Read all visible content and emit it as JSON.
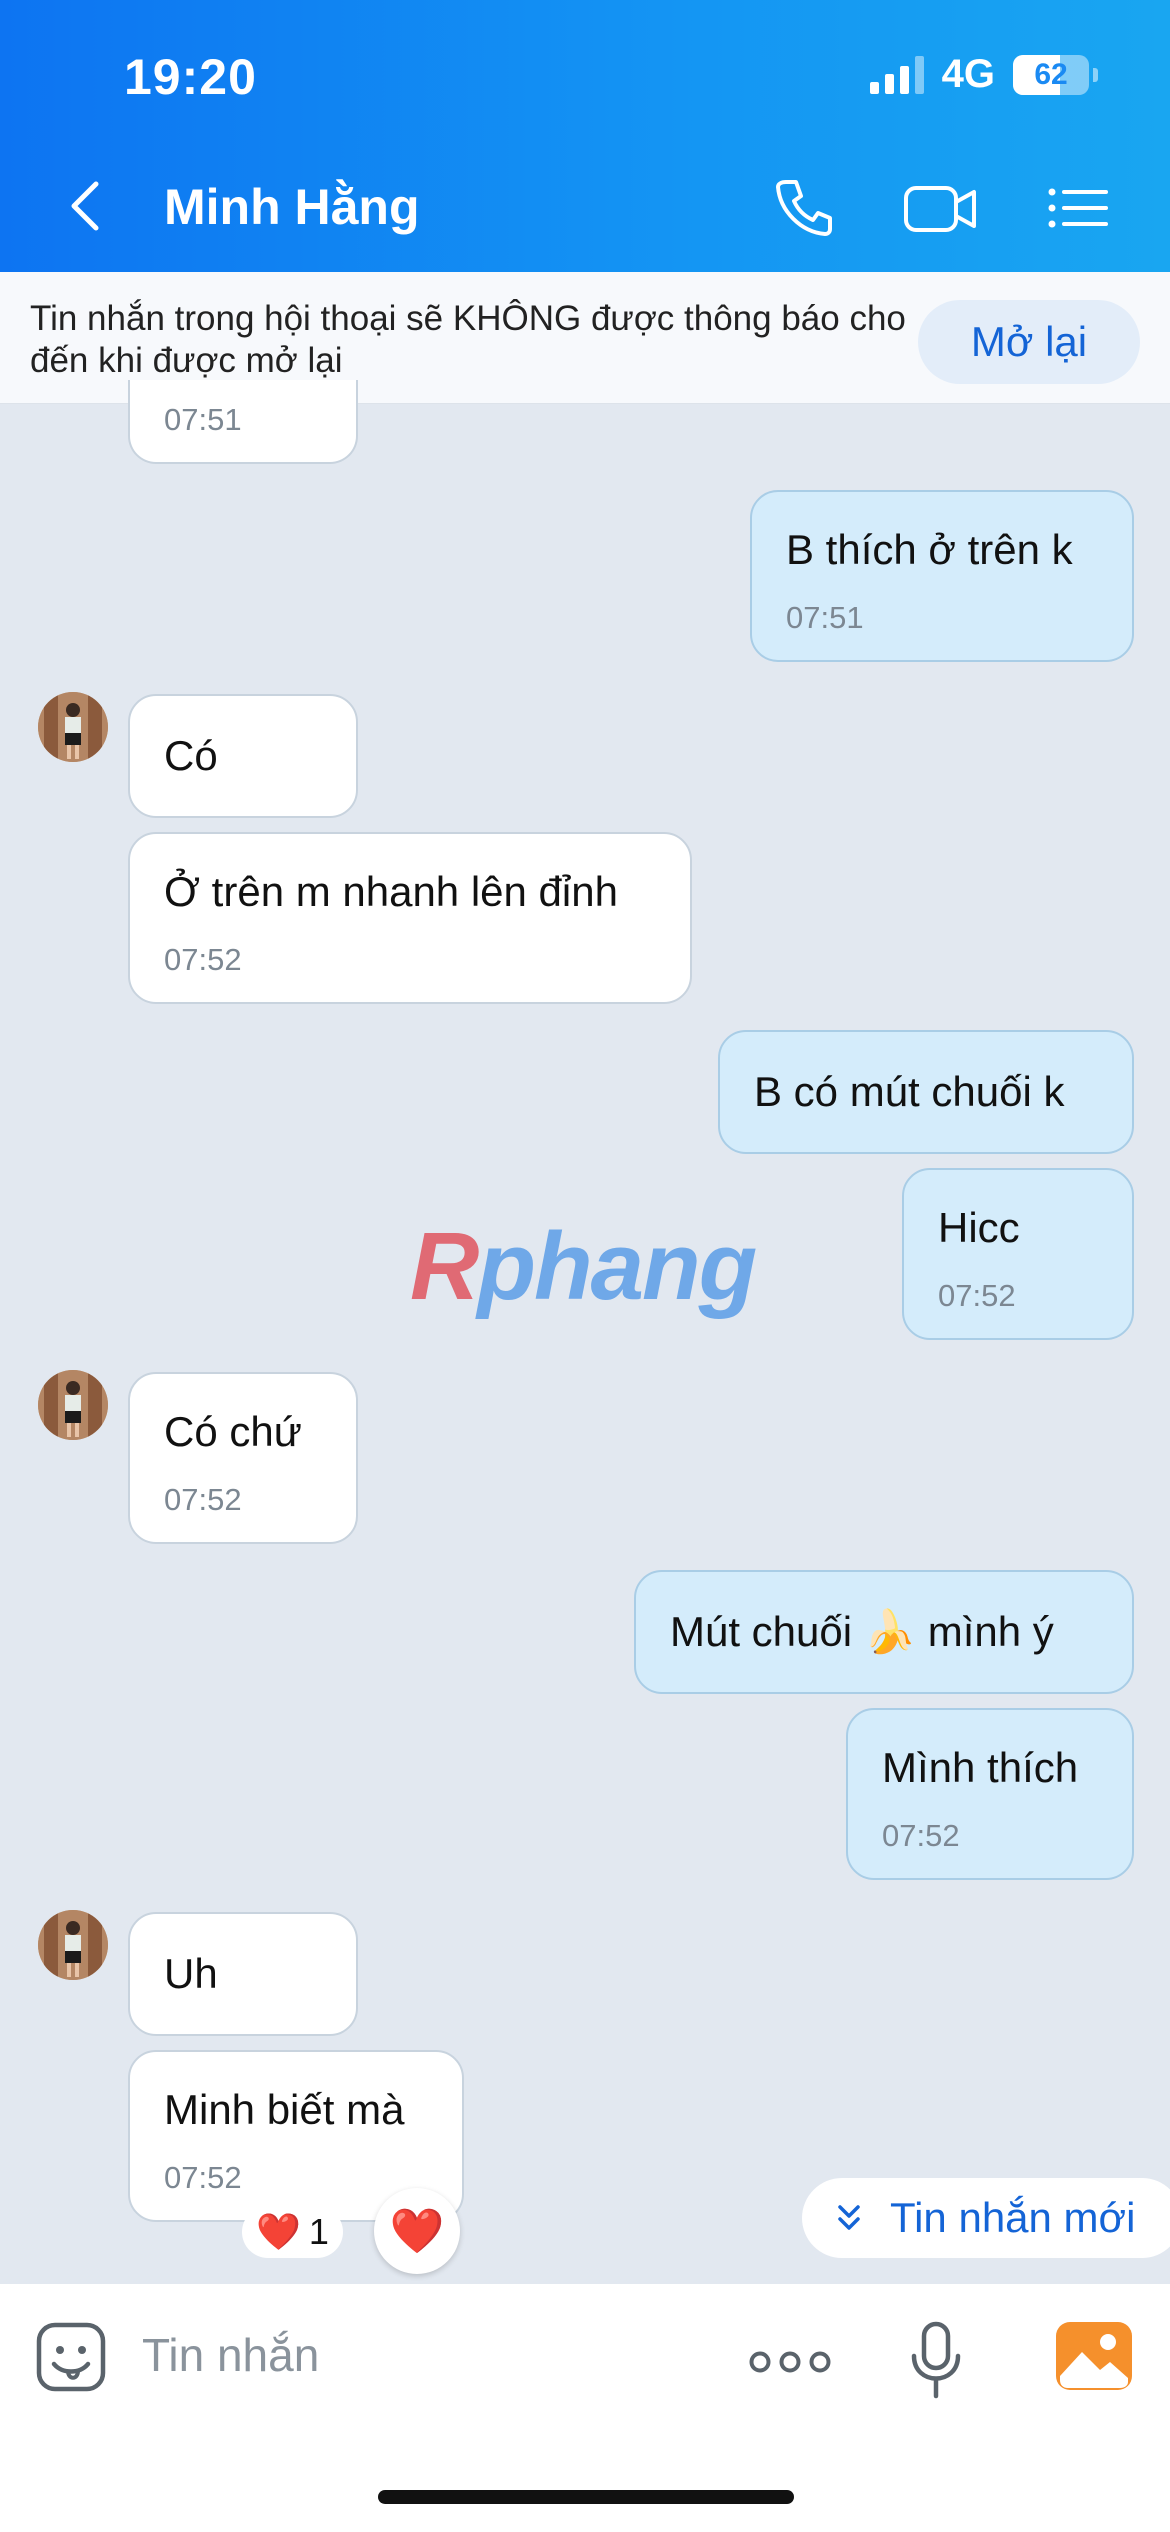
{
  "status_bar": {
    "time": "19:20",
    "network": "4G",
    "battery": "62",
    "battery_level": 0.62
  },
  "header": {
    "contact_name": "Minh Hằng"
  },
  "banner": {
    "text": "Tin nhắn trong hội thoại sẽ KHÔNG được thông báo cho đến khi được mở lại",
    "button": "Mở lại"
  },
  "messages": [
    {
      "side": "in",
      "text": "",
      "time": "07:51"
    },
    {
      "side": "out",
      "text": "B thích ở trên k",
      "time": "07:51"
    },
    {
      "side": "in",
      "text": "Có",
      "time": ""
    },
    {
      "side": "in",
      "text": "Ở trên m nhanh lên đỉnh",
      "time": "07:52"
    },
    {
      "side": "out",
      "text": "B có mút chuối k",
      "time": ""
    },
    {
      "side": "out",
      "text": "Hicc",
      "time": "07:52"
    },
    {
      "side": "in",
      "text": "Có chứ",
      "time": "07:52"
    },
    {
      "side": "out",
      "text": "Mút chuối 🍌 mình ý",
      "time": ""
    },
    {
      "side": "out",
      "text": "Mình thích",
      "time": "07:52"
    },
    {
      "side": "in",
      "text": "Uh",
      "time": ""
    },
    {
      "side": "in",
      "text": "Minh biết mà",
      "time": "07:52"
    }
  ],
  "reaction": {
    "emoji": "❤️",
    "count": "1",
    "button_emoji": "❤️"
  },
  "watermark": {
    "first": "R",
    "rest": "phang"
  },
  "new_messages_button": "Tin nhắn mới",
  "input": {
    "placeholder": "Tin nhắn"
  },
  "icons": [
    "back-icon",
    "phone-icon",
    "video-call-icon",
    "menu-list-icon",
    "sticker-icon",
    "more-dots-icon",
    "microphone-icon",
    "image-icon",
    "chevron-double-down-icon"
  ]
}
